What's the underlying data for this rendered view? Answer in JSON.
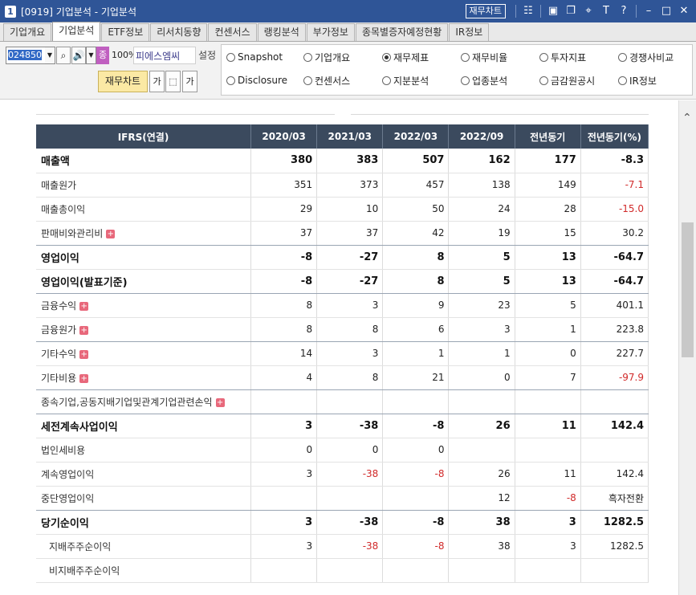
{
  "window": {
    "number": "1",
    "title": "[0919] 기업분석 - 기업분석",
    "fin_chart_button": "재무차트",
    "icons": [
      "chart-icon",
      "restore-icon",
      "tile-icon",
      "pin-icon",
      "font-icon",
      "help-icon",
      "minimize-icon",
      "maximize-icon",
      "close-icon"
    ]
  },
  "tabs": [
    {
      "label": "기업개요",
      "active": false
    },
    {
      "label": "기업분석",
      "active": true
    },
    {
      "label": "ETF정보",
      "active": false
    },
    {
      "label": "리서치동향",
      "active": false
    },
    {
      "label": "컨센서스",
      "active": false
    },
    {
      "label": "랭킹분석",
      "active": false
    },
    {
      "label": "부가정보",
      "active": false
    },
    {
      "label": "종목별증자예정현황",
      "active": false
    },
    {
      "label": "IR정보",
      "active": false
    }
  ],
  "controls": {
    "code": "024850",
    "jong_badge": "종",
    "pct": "100%",
    "company": "피에스엠씨",
    "setting_label": "설정",
    "fin_chart_label": "재무차트",
    "font_btn_1": "가",
    "font_btn_2": "가"
  },
  "radios": [
    {
      "label": "Snapshot",
      "checked": false
    },
    {
      "label": "기업개요",
      "checked": false
    },
    {
      "label": "재무제표",
      "checked": true
    },
    {
      "label": "재무비율",
      "checked": false
    },
    {
      "label": "투자지표",
      "checked": false
    },
    {
      "label": "경쟁사비교",
      "checked": false
    },
    {
      "label": "Disclosure",
      "checked": false
    },
    {
      "label": "컨센서스",
      "checked": false
    },
    {
      "label": "지분분석",
      "checked": false
    },
    {
      "label": "업종분석",
      "checked": false
    },
    {
      "label": "금감원공시",
      "checked": false
    },
    {
      "label": "IR정보",
      "checked": false
    }
  ],
  "table": {
    "headers": [
      "IFRS(연결)",
      "2020/03",
      "2021/03",
      "2022/03",
      "2022/09",
      "전년동기",
      "전년동기(%)"
    ],
    "rows": [
      {
        "label": "매출액",
        "bold": true,
        "sep": false,
        "indent": false,
        "plus": false,
        "cells": [
          "380",
          "383",
          "507",
          "162",
          "177",
          "-8.3"
        ]
      },
      {
        "label": "매출원가",
        "bold": false,
        "sep": false,
        "indent": false,
        "plus": false,
        "cells": [
          "351",
          "373",
          "457",
          "138",
          "149",
          "-7.1"
        ]
      },
      {
        "label": "매출총이익",
        "bold": false,
        "sep": false,
        "indent": false,
        "plus": false,
        "cells": [
          "29",
          "10",
          "50",
          "24",
          "28",
          "-15.0"
        ]
      },
      {
        "label": "판매비와관리비",
        "bold": false,
        "sep": true,
        "indent": false,
        "plus": true,
        "cells": [
          "37",
          "37",
          "42",
          "19",
          "15",
          "30.2"
        ]
      },
      {
        "label": "영업이익",
        "bold": true,
        "sep": false,
        "indent": false,
        "plus": false,
        "cells": [
          "-8",
          "-27",
          "8",
          "5",
          "13",
          "-64.7"
        ]
      },
      {
        "label": "영업이익(발표기준)",
        "bold": true,
        "sep": true,
        "indent": false,
        "plus": false,
        "cells": [
          "-8",
          "-27",
          "8",
          "5",
          "13",
          "-64.7"
        ]
      },
      {
        "label": "금융수익",
        "bold": false,
        "sep": false,
        "indent": false,
        "plus": true,
        "cells": [
          "8",
          "3",
          "9",
          "23",
          "5",
          "401.1"
        ]
      },
      {
        "label": "금융원가",
        "bold": false,
        "sep": true,
        "indent": false,
        "plus": true,
        "cells": [
          "8",
          "8",
          "6",
          "3",
          "1",
          "223.8"
        ]
      },
      {
        "label": "기타수익",
        "bold": false,
        "sep": false,
        "indent": false,
        "plus": true,
        "cells": [
          "14",
          "3",
          "1",
          "1",
          "0",
          "227.7"
        ]
      },
      {
        "label": "기타비용",
        "bold": false,
        "sep": true,
        "indent": false,
        "plus": true,
        "cells": [
          "4",
          "8",
          "21",
          "0",
          "7",
          "-97.9"
        ]
      },
      {
        "label": "종속기업,공동지배기업및관계기업관련손익",
        "bold": false,
        "sep": true,
        "indent": false,
        "plus": true,
        "cells": [
          "",
          "",
          "",
          "",
          "",
          ""
        ]
      },
      {
        "label": "세전계속사업이익",
        "bold": true,
        "sep": false,
        "indent": false,
        "plus": false,
        "cells": [
          "3",
          "-38",
          "-8",
          "26",
          "11",
          "142.4"
        ]
      },
      {
        "label": "법인세비용",
        "bold": false,
        "sep": false,
        "indent": false,
        "plus": false,
        "cells": [
          "0",
          "0",
          "0",
          "",
          "",
          ""
        ]
      },
      {
        "label": "계속영업이익",
        "bold": false,
        "sep": false,
        "indent": false,
        "plus": false,
        "cells": [
          "3",
          "-38",
          "-8",
          "26",
          "11",
          "142.4"
        ]
      },
      {
        "label": "중단영업이익",
        "bold": false,
        "sep": true,
        "indent": false,
        "plus": false,
        "cells": [
          "",
          "",
          "",
          "12",
          "-8",
          "흑자전환"
        ]
      },
      {
        "label": "당기순이익",
        "bold": true,
        "sep": false,
        "indent": false,
        "plus": false,
        "cells": [
          "3",
          "-38",
          "-8",
          "38",
          "3",
          "1282.5"
        ]
      },
      {
        "label": "지배주주순이익",
        "bold": false,
        "sep": false,
        "indent": true,
        "plus": false,
        "cells": [
          "3",
          "-38",
          "-8",
          "38",
          "3",
          "1282.5"
        ]
      },
      {
        "label": "비지배주주순이익",
        "bold": false,
        "sep": false,
        "indent": true,
        "plus": false,
        "cells": [
          "",
          "",
          "",
          "",
          "",
          ""
        ]
      }
    ]
  }
}
